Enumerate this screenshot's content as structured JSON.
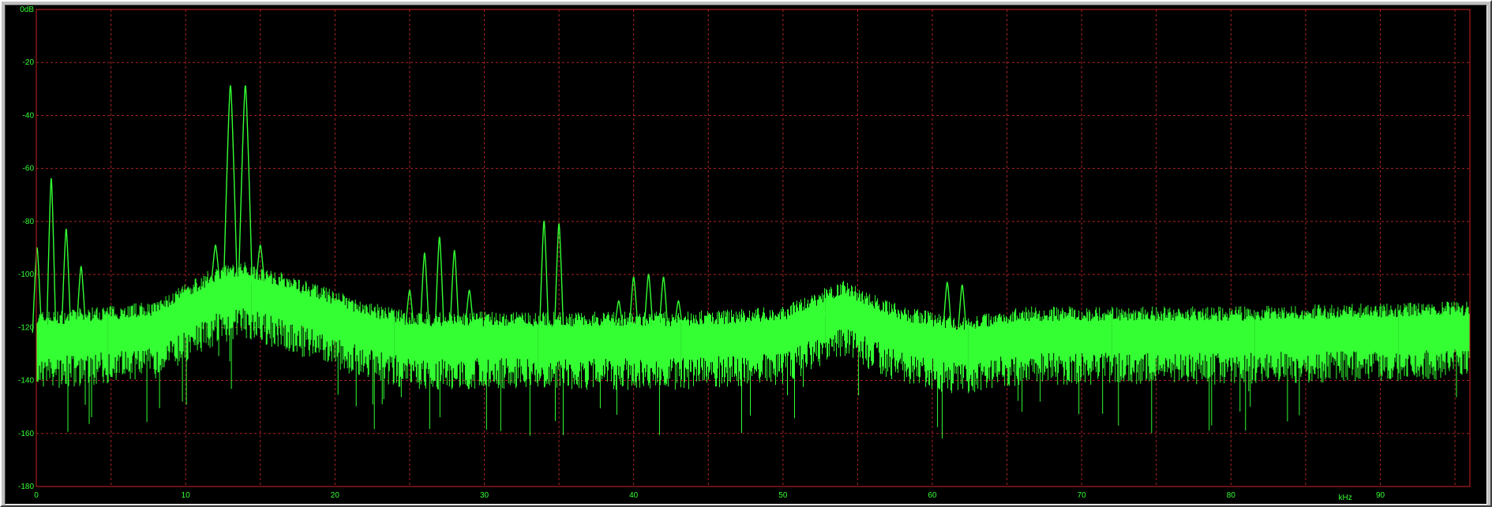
{
  "colors": {
    "background": "#000000",
    "frame": "#cc2222",
    "grid": "#aa2222",
    "trace": "#33ff33",
    "label": "#33ff33"
  },
  "chart_data": {
    "type": "line",
    "title": "",
    "xlabel": "kHz",
    "ylabel": "",
    "xlim": [
      0,
      96
    ],
    "ylim": [
      -180,
      0
    ],
    "grid": true,
    "x_ticks": [
      0,
      10,
      20,
      30,
      40,
      50,
      60,
      70,
      80,
      90
    ],
    "x_tick_labels": [
      "0",
      "10",
      "20",
      "30",
      "40",
      "50",
      "60",
      "70",
      "80",
      "90"
    ],
    "x_minor_ticks": [
      5,
      15,
      25,
      35,
      45,
      55,
      65,
      75,
      85,
      95
    ],
    "y_ticks": [
      0,
      -20,
      -40,
      -60,
      -80,
      -100,
      -120,
      -140,
      -160,
      -180
    ],
    "y_tick_labels": [
      "0dB",
      "-20",
      "-40",
      "-60",
      "-80",
      "-100",
      "-120",
      "-140",
      "-160",
      "-180"
    ],
    "series": [
      {
        "noise_floor_db": -122,
        "noise_spread_db": 8,
        "floor_contour": [
          [
            0,
            -122
          ],
          [
            8,
            -118
          ],
          [
            12,
            -105
          ],
          [
            14,
            -103
          ],
          [
            17,
            -108
          ],
          [
            22,
            -118
          ],
          [
            25,
            -122
          ],
          [
            30,
            -122
          ],
          [
            38,
            -122
          ],
          [
            43,
            -122
          ],
          [
            50,
            -120
          ],
          [
            54,
            -110
          ],
          [
            58,
            -120
          ],
          [
            62,
            -124
          ],
          [
            66,
            -120
          ],
          [
            80,
            -120
          ],
          [
            96,
            -118
          ]
        ],
        "peaks": [
          {
            "x": 0.05,
            "y": -90
          },
          {
            "x": 1.0,
            "y": -64
          },
          {
            "x": 2.0,
            "y": -83
          },
          {
            "x": 3.0,
            "y": -97
          },
          {
            "x": 12.0,
            "y": -89
          },
          {
            "x": 13.0,
            "y": -29
          },
          {
            "x": 14.0,
            "y": -29
          },
          {
            "x": 15.0,
            "y": -89
          },
          {
            "x": 25.0,
            "y": -106
          },
          {
            "x": 26.0,
            "y": -92
          },
          {
            "x": 27.0,
            "y": -86
          },
          {
            "x": 28.0,
            "y": -91
          },
          {
            "x": 29.0,
            "y": -106
          },
          {
            "x": 34.0,
            "y": -80
          },
          {
            "x": 35.0,
            "y": -81
          },
          {
            "x": 39.0,
            "y": -110
          },
          {
            "x": 40.0,
            "y": -101
          },
          {
            "x": 41.0,
            "y": -100
          },
          {
            "x": 42.0,
            "y": -101
          },
          {
            "x": 43.0,
            "y": -110
          },
          {
            "x": 53.0,
            "y": -117
          },
          {
            "x": 54.0,
            "y": -113
          },
          {
            "x": 55.0,
            "y": -116
          },
          {
            "x": 61.0,
            "y": -103
          },
          {
            "x": 62.0,
            "y": -104
          }
        ]
      }
    ]
  }
}
